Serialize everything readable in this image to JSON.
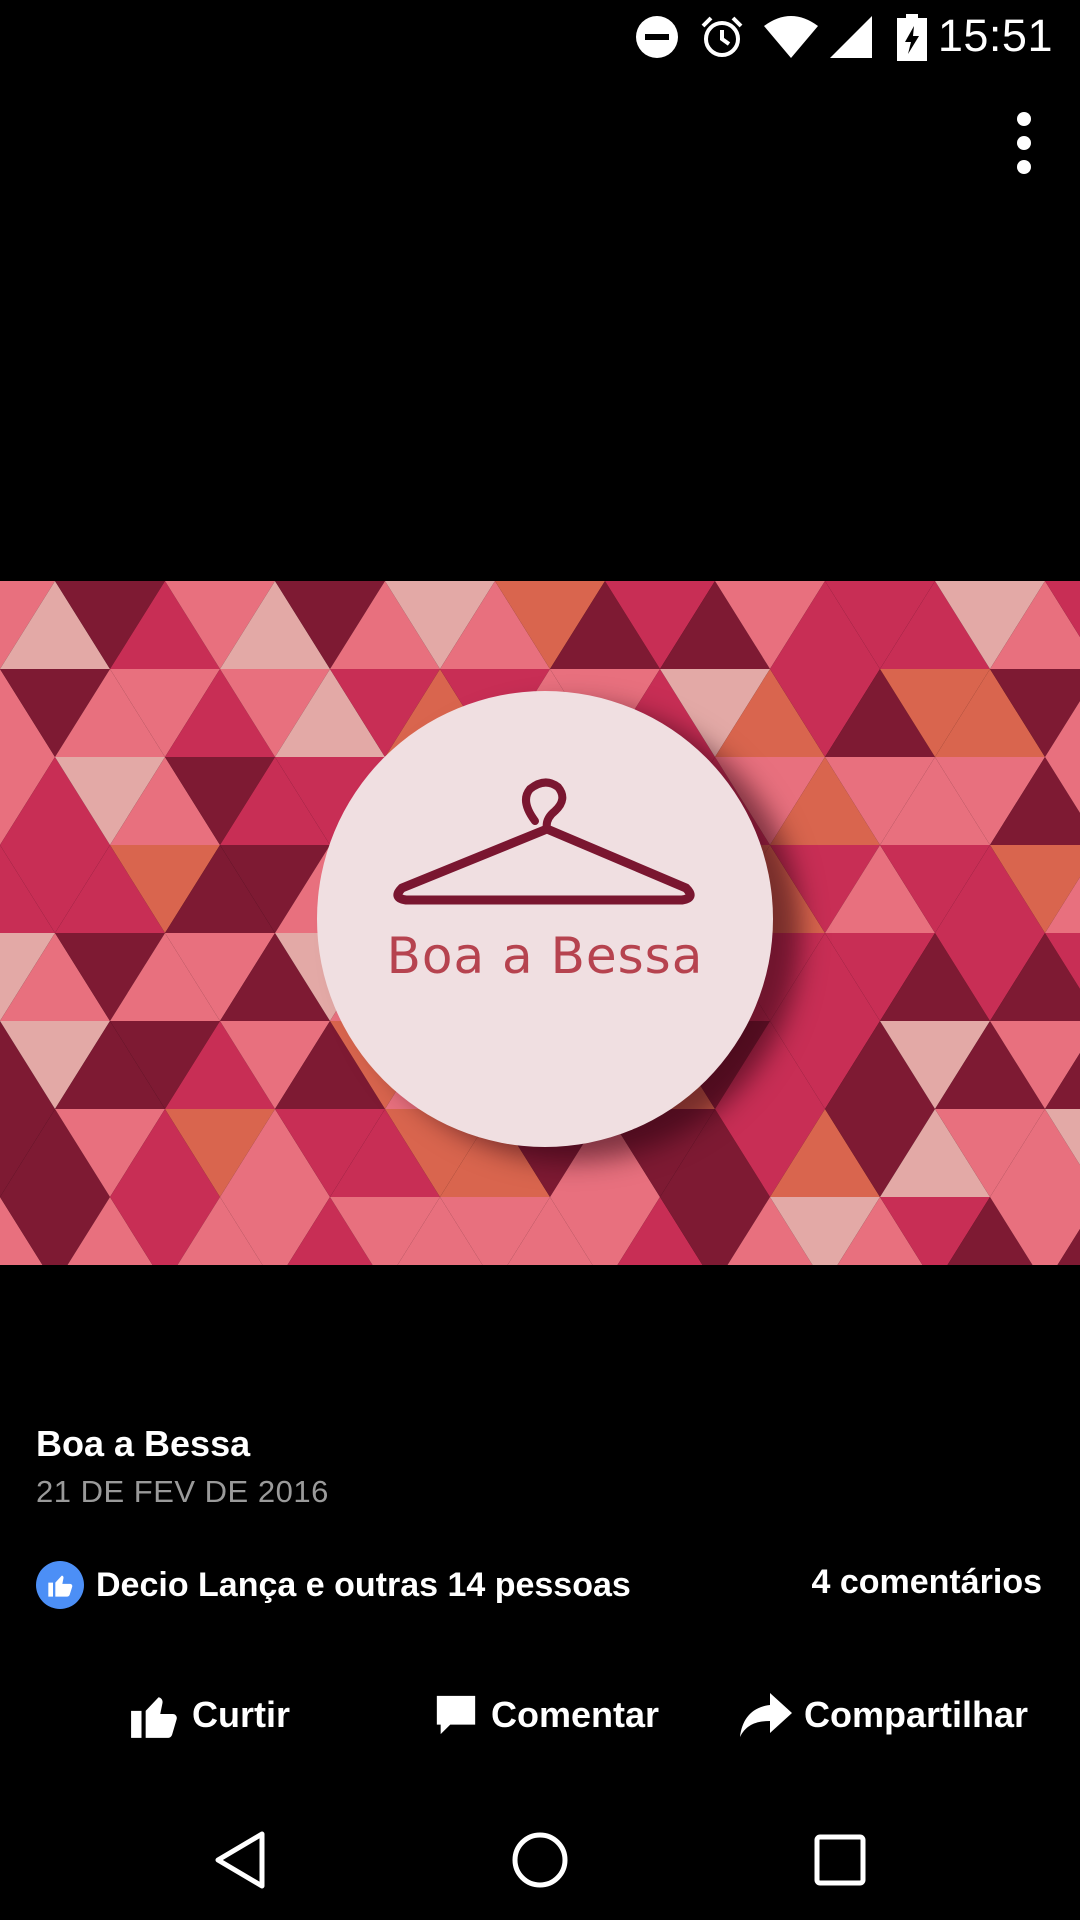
{
  "status_bar": {
    "time": "15:51",
    "icons": [
      "do-not-disturb-icon",
      "alarm-icon",
      "wifi-icon",
      "cell-signal-icon",
      "battery-charging-icon"
    ]
  },
  "menu": {
    "icon": "more-vert-icon"
  },
  "photo": {
    "logo_text": "Boa a Bessa",
    "logo_icon": "hanger-icon",
    "colors": {
      "dark": "#7e1a33",
      "crimson": "#c82e55",
      "coral": "#d9654e",
      "pink": "#e8707e",
      "blush": "#e3a9a6",
      "circle": "#f0dfe1",
      "text": "#b6434f"
    }
  },
  "post": {
    "title": "Boa a Bessa",
    "date": "21 DE FEV DE 2016"
  },
  "reactions": {
    "icon": "thumbs-up-icon",
    "text": "Decio Lança e outras 14 pessoas",
    "comments": "4 comentários",
    "badge_color": "#4c8ff6"
  },
  "actions": {
    "like_label": "Curtir",
    "comment_label": "Comentar",
    "share_label": "Compartilhar"
  },
  "nav": {
    "icons": [
      "back-icon",
      "home-icon",
      "recents-icon"
    ]
  }
}
